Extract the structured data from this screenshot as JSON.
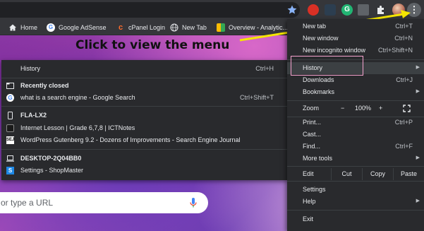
{
  "toolbar": {
    "icons": [
      "star-icon",
      "shield-extension-icon",
      "grid-extension-icon",
      "grammarly-extension-icon",
      "puzzle-extension-icon",
      "extensions-icon",
      "profile-avatar",
      "kebab-menu-icon"
    ],
    "grammarly_letter": "G",
    "menu_glyph": "⋮"
  },
  "bookmarks": [
    {
      "label": "Home",
      "icon": "home-icon"
    },
    {
      "label": "Google AdSense",
      "icon": "google-icon"
    },
    {
      "label": "cPanel Login",
      "icon": "cpanel-icon"
    },
    {
      "label": "New Tab",
      "icon": "globe-icon"
    },
    {
      "label": "Overview - Analytic...",
      "icon": "analytics-icon"
    }
  ],
  "annotation": {
    "text": "Click to view the menu",
    "arrow_color": "#f5e600"
  },
  "search": {
    "placeholder": "or type a URL"
  },
  "history_menu": {
    "history_label": "History",
    "history_shortcut": "Ctrl+H",
    "recently_closed_heading": "Recently closed",
    "recently_closed_items": [
      {
        "label": "what is a search engine - Google Search",
        "shortcut": "Ctrl+Shift+T",
        "icon": "google-icon"
      }
    ],
    "devices": [
      {
        "name": "FLA-LX2",
        "icon": "phone-icon",
        "tabs": [
          {
            "label": "Internet Lesson | Grade 6,7,8 | ICTNotes",
            "icon": "ictnotes-icon"
          },
          {
            "label": "WordPress Gutenberg 9.2 - Dozens of Improvements - Search Engine Journal",
            "icon": "sej-icon"
          }
        ]
      },
      {
        "name": "DESKTOP-2Q04BB0",
        "icon": "laptop-icon",
        "tabs": [
          {
            "label": "Settings - ShopMaster",
            "icon": "shopmaster-icon"
          }
        ]
      }
    ],
    "google_letter": "G",
    "sej_letters": "SEJ",
    "shopmaster_letter": "S"
  },
  "main_menu": {
    "new_tab": {
      "label": "New tab",
      "shortcut": "Ctrl+T"
    },
    "new_window": {
      "label": "New window",
      "shortcut": "Ctrl+N"
    },
    "new_incognito": {
      "label": "New incognito window",
      "shortcut": "Ctrl+Shift+N"
    },
    "history": {
      "label": "History"
    },
    "downloads": {
      "label": "Downloads",
      "shortcut": "Ctrl+J"
    },
    "bookmarks": {
      "label": "Bookmarks"
    },
    "zoom": {
      "label": "Zoom",
      "minus": "−",
      "value": "100%",
      "plus": "+",
      "fullscreen_icon": "fullscreen-icon"
    },
    "print": {
      "label": "Print...",
      "shortcut": "Ctrl+P"
    },
    "cast": {
      "label": "Cast..."
    },
    "find": {
      "label": "Find...",
      "shortcut": "Ctrl+F"
    },
    "more_tools": {
      "label": "More tools"
    },
    "edit": {
      "label": "Edit",
      "cut": "Cut",
      "copy": "Copy",
      "paste": "Paste"
    },
    "settings": {
      "label": "Settings"
    },
    "help": {
      "label": "Help"
    },
    "exit": {
      "label": "Exit"
    },
    "submenu_arrow": "▶"
  },
  "colors": {
    "menu_bg": "#292a2d",
    "toolbar_bg": "#35363a",
    "highlight_border": "#f6a3cf",
    "arrow_yellow": "#f5e600"
  }
}
